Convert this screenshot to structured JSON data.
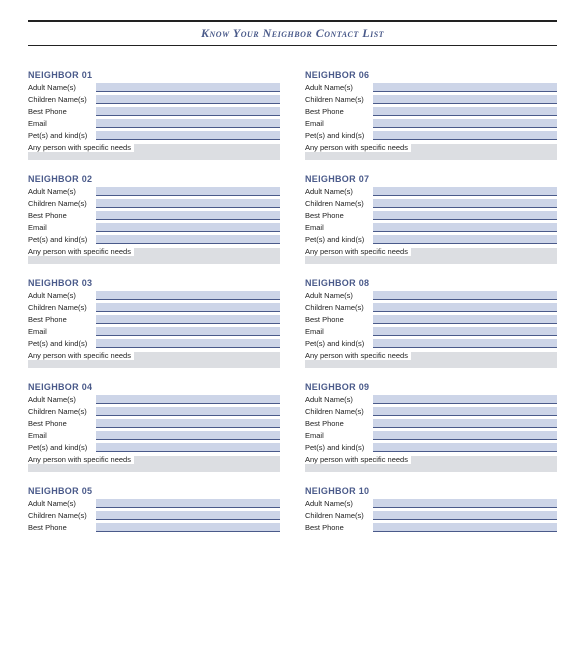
{
  "title": "Know Your Neighbor Contact List",
  "fieldLabels": {
    "adult": "Adult Name(s)",
    "children": "Children Name(s)",
    "phone": "Best Phone",
    "email": "Email",
    "pets": "Pet(s) and kind(s)",
    "needs": "Any person with specific needs"
  },
  "leftCol": [
    {
      "head": "NEIGHBOR  01",
      "full": true
    },
    {
      "head": "NEIGHBOR  02",
      "full": true
    },
    {
      "head": "NEIGHBOR  03",
      "full": true
    },
    {
      "head": "NEIGHBOR  04",
      "full": true
    },
    {
      "head": "NEIGHBOR  05",
      "full": false
    }
  ],
  "rightCol": [
    {
      "head": "NEIGHBOR  06",
      "full": true
    },
    {
      "head": "NEIGHBOR  07",
      "full": true
    },
    {
      "head": "NEIGHBOR  08",
      "full": true
    },
    {
      "head": "NEIGHBOR  09",
      "full": true
    },
    {
      "head": "NEIGHBOR  10",
      "full": false
    }
  ]
}
